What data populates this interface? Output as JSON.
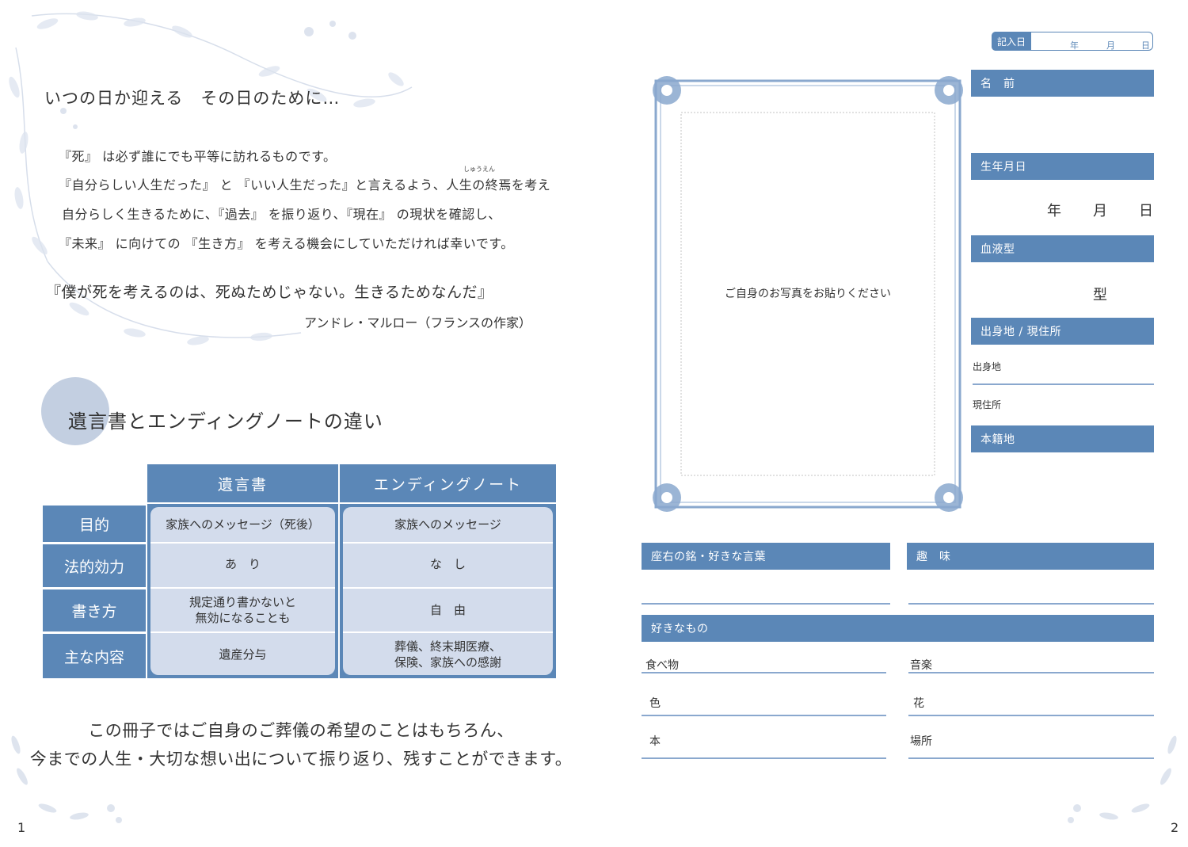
{
  "left_page": {
    "intro_title": "いつの日か迎える　その日のために…",
    "intro_lines": [
      "『死』 は必ず誰にでも平等に訪れるものです。",
      "『自分らしい人生だった』 と 『いい人生だった』と言えるよう、人生の終焉を考え",
      "自分らしく生きるために、『過去』 を振り返り、『現在』 の現状を確認し、",
      "『未来』 に向けての 『生き方』 を考える機会にしていただければ幸いです。"
    ],
    "ruby": "しゅうえん",
    "quote": "『僕が死を考えるのは、死ぬためじゃない。生きるためなんだ』",
    "quote_author": "アンドレ・マルロー（フランスの作家）",
    "section_title": "遺言書とエンディングノートの違い",
    "comparison_table": {
      "columns": [
        "遺言書",
        "エンディングノート"
      ],
      "rows": [
        {
          "label": "目的",
          "will": "家族へのメッセージ（死後）",
          "note": "家族へのメッセージ"
        },
        {
          "label": "法的効力",
          "will": "あ　り",
          "note": "な　し"
        },
        {
          "label": "書き方",
          "will": "規定通り書かないと\n無効になることも",
          "note": "自　由"
        },
        {
          "label": "主な内容",
          "will": "遺産分与",
          "note": "葬儀、終末期医療、\n保険、家族への感謝"
        }
      ]
    },
    "closing_lines": [
      "この冊子ではご自身のご葬儀の希望のことはもちろん、",
      "今までの人生・大切な想い出について振り返り、残すことができます。"
    ],
    "page_number": "1"
  },
  "right_page": {
    "entry_date": {
      "label": "記入日",
      "year": "年",
      "month": "月",
      "day": "日"
    },
    "photo_placeholder": "ご自身のお写真をお貼りください",
    "fields": {
      "name": "名　前",
      "birthdate": "生年月日",
      "birthdate_units": {
        "year": "年",
        "month": "月",
        "day": "日"
      },
      "blood_type": "血液型",
      "blood_type_unit": "型",
      "origin_residence": "出身地 / 現住所",
      "origin": "出身地",
      "residence": "現住所",
      "registered_domicile": "本籍地",
      "motto": "座右の銘・好きな言葉",
      "hobby": "趣　味",
      "favorites": "好きなもの",
      "favorite_items": {
        "food": "食べ物",
        "music": "音楽",
        "color": "色",
        "flower": "花",
        "book": "本",
        "place": "場所"
      }
    },
    "page_number": "2"
  },
  "colors": {
    "accent_blue": "#5b87b7",
    "light_blue": "#d3dcec",
    "circle": "#c3cfe1",
    "line": "#8aa8ce"
  }
}
